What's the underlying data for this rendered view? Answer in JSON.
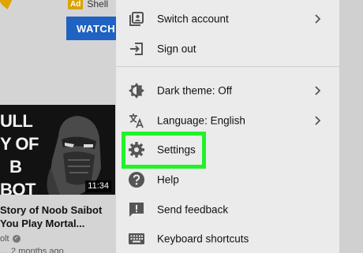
{
  "background": {
    "ad_badge": "Ad",
    "ad_channel": "Shell",
    "watch_button": "WATCH",
    "video": {
      "thumbnail_lines": [
        "ULL",
        "Y OF",
        "B",
        "BOT"
      ],
      "duration": "11:34",
      "title": "Story of Noob Saibot You Play Mortal...",
      "channel": "olt",
      "meta": "… 2 months ago"
    }
  },
  "menu": {
    "items": [
      {
        "label": "Switch account",
        "icon": "switch-account-icon",
        "chevron": true
      },
      {
        "label": "Sign out",
        "icon": "sign-out-icon",
        "chevron": false
      },
      {
        "label": "Dark theme: Off",
        "icon": "dark-theme-icon",
        "chevron": true
      },
      {
        "label": "Language: English",
        "icon": "language-icon",
        "chevron": true
      },
      {
        "label": "Settings",
        "icon": "gear-icon",
        "chevron": false
      },
      {
        "label": "Help",
        "icon": "help-icon",
        "chevron": false
      },
      {
        "label": "Send feedback",
        "icon": "feedback-icon",
        "chevron": false
      },
      {
        "label": "Keyboard shortcuts",
        "icon": "keyboard-icon",
        "chevron": false
      }
    ]
  },
  "colors": {
    "menu_background": "#ebebeb",
    "highlight": "#21f229",
    "watch_button": "#1f62c2",
    "ad_badge": "#d9a300"
  }
}
